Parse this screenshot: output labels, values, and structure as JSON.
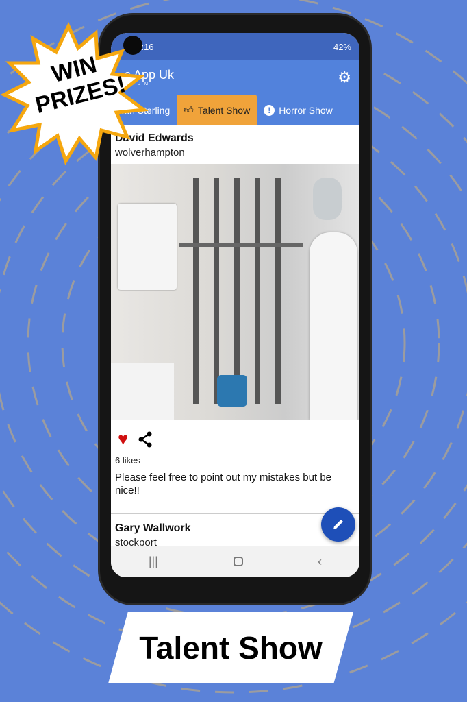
{
  "status_bar": {
    "time": "10:16",
    "battery": "42%"
  },
  "app": {
    "logo": "s App Uk",
    "logo_sub": "MIUM"
  },
  "tabs": [
    {
      "label": "with Sterling"
    },
    {
      "label": "Talent Show",
      "active": true
    },
    {
      "label": "Horror Show"
    }
  ],
  "posts": [
    {
      "name": "David Edwards",
      "location": "wolverhampton",
      "likes": "6 likes",
      "caption": "Please feel free to point out my mistakes but be nice!!",
      "liked": true
    },
    {
      "name": "Gary Wallwork",
      "location": "stockport"
    }
  ],
  "promo": {
    "burst": "WIN PRIZES!",
    "banner": "Talent Show"
  },
  "colors": {
    "background": "#5b82d8",
    "appbar": "#5282dc",
    "active_tab": "#f0a33a",
    "fab": "#1e4fb8",
    "heart": "#d01010"
  }
}
